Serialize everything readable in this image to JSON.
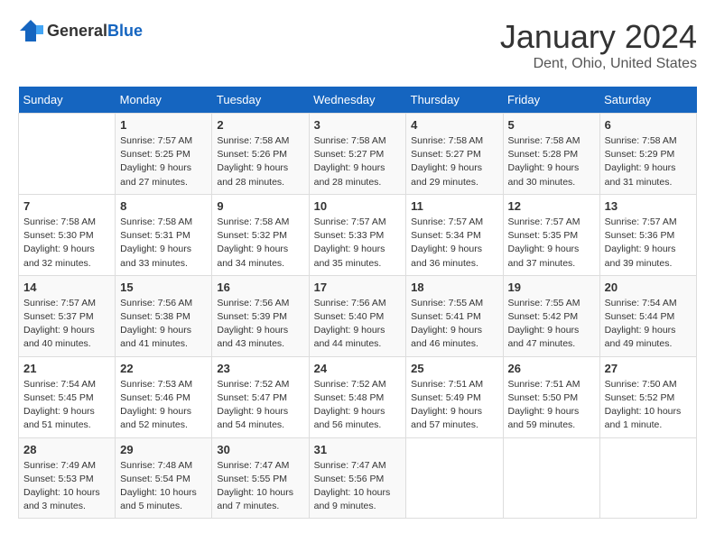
{
  "header": {
    "logo_general": "General",
    "logo_blue": "Blue",
    "title": "January 2024",
    "subtitle": "Dent, Ohio, United States"
  },
  "days_of_week": [
    "Sunday",
    "Monday",
    "Tuesday",
    "Wednesday",
    "Thursday",
    "Friday",
    "Saturday"
  ],
  "weeks": [
    [
      {
        "day": "",
        "sunrise": "",
        "sunset": "",
        "daylight": ""
      },
      {
        "day": "1",
        "sunrise": "Sunrise: 7:57 AM",
        "sunset": "Sunset: 5:25 PM",
        "daylight": "Daylight: 9 hours and 27 minutes."
      },
      {
        "day": "2",
        "sunrise": "Sunrise: 7:58 AM",
        "sunset": "Sunset: 5:26 PM",
        "daylight": "Daylight: 9 hours and 28 minutes."
      },
      {
        "day": "3",
        "sunrise": "Sunrise: 7:58 AM",
        "sunset": "Sunset: 5:27 PM",
        "daylight": "Daylight: 9 hours and 28 minutes."
      },
      {
        "day": "4",
        "sunrise": "Sunrise: 7:58 AM",
        "sunset": "Sunset: 5:27 PM",
        "daylight": "Daylight: 9 hours and 29 minutes."
      },
      {
        "day": "5",
        "sunrise": "Sunrise: 7:58 AM",
        "sunset": "Sunset: 5:28 PM",
        "daylight": "Daylight: 9 hours and 30 minutes."
      },
      {
        "day": "6",
        "sunrise": "Sunrise: 7:58 AM",
        "sunset": "Sunset: 5:29 PM",
        "daylight": "Daylight: 9 hours and 31 minutes."
      }
    ],
    [
      {
        "day": "7",
        "sunrise": "Sunrise: 7:58 AM",
        "sunset": "Sunset: 5:30 PM",
        "daylight": "Daylight: 9 hours and 32 minutes."
      },
      {
        "day": "8",
        "sunrise": "Sunrise: 7:58 AM",
        "sunset": "Sunset: 5:31 PM",
        "daylight": "Daylight: 9 hours and 33 minutes."
      },
      {
        "day": "9",
        "sunrise": "Sunrise: 7:58 AM",
        "sunset": "Sunset: 5:32 PM",
        "daylight": "Daylight: 9 hours and 34 minutes."
      },
      {
        "day": "10",
        "sunrise": "Sunrise: 7:57 AM",
        "sunset": "Sunset: 5:33 PM",
        "daylight": "Daylight: 9 hours and 35 minutes."
      },
      {
        "day": "11",
        "sunrise": "Sunrise: 7:57 AM",
        "sunset": "Sunset: 5:34 PM",
        "daylight": "Daylight: 9 hours and 36 minutes."
      },
      {
        "day": "12",
        "sunrise": "Sunrise: 7:57 AM",
        "sunset": "Sunset: 5:35 PM",
        "daylight": "Daylight: 9 hours and 37 minutes."
      },
      {
        "day": "13",
        "sunrise": "Sunrise: 7:57 AM",
        "sunset": "Sunset: 5:36 PM",
        "daylight": "Daylight: 9 hours and 39 minutes."
      }
    ],
    [
      {
        "day": "14",
        "sunrise": "Sunrise: 7:57 AM",
        "sunset": "Sunset: 5:37 PM",
        "daylight": "Daylight: 9 hours and 40 minutes."
      },
      {
        "day": "15",
        "sunrise": "Sunrise: 7:56 AM",
        "sunset": "Sunset: 5:38 PM",
        "daylight": "Daylight: 9 hours and 41 minutes."
      },
      {
        "day": "16",
        "sunrise": "Sunrise: 7:56 AM",
        "sunset": "Sunset: 5:39 PM",
        "daylight": "Daylight: 9 hours and 43 minutes."
      },
      {
        "day": "17",
        "sunrise": "Sunrise: 7:56 AM",
        "sunset": "Sunset: 5:40 PM",
        "daylight": "Daylight: 9 hours and 44 minutes."
      },
      {
        "day": "18",
        "sunrise": "Sunrise: 7:55 AM",
        "sunset": "Sunset: 5:41 PM",
        "daylight": "Daylight: 9 hours and 46 minutes."
      },
      {
        "day": "19",
        "sunrise": "Sunrise: 7:55 AM",
        "sunset": "Sunset: 5:42 PM",
        "daylight": "Daylight: 9 hours and 47 minutes."
      },
      {
        "day": "20",
        "sunrise": "Sunrise: 7:54 AM",
        "sunset": "Sunset: 5:44 PM",
        "daylight": "Daylight: 9 hours and 49 minutes."
      }
    ],
    [
      {
        "day": "21",
        "sunrise": "Sunrise: 7:54 AM",
        "sunset": "Sunset: 5:45 PM",
        "daylight": "Daylight: 9 hours and 51 minutes."
      },
      {
        "day": "22",
        "sunrise": "Sunrise: 7:53 AM",
        "sunset": "Sunset: 5:46 PM",
        "daylight": "Daylight: 9 hours and 52 minutes."
      },
      {
        "day": "23",
        "sunrise": "Sunrise: 7:52 AM",
        "sunset": "Sunset: 5:47 PM",
        "daylight": "Daylight: 9 hours and 54 minutes."
      },
      {
        "day": "24",
        "sunrise": "Sunrise: 7:52 AM",
        "sunset": "Sunset: 5:48 PM",
        "daylight": "Daylight: 9 hours and 56 minutes."
      },
      {
        "day": "25",
        "sunrise": "Sunrise: 7:51 AM",
        "sunset": "Sunset: 5:49 PM",
        "daylight": "Daylight: 9 hours and 57 minutes."
      },
      {
        "day": "26",
        "sunrise": "Sunrise: 7:51 AM",
        "sunset": "Sunset: 5:50 PM",
        "daylight": "Daylight: 9 hours and 59 minutes."
      },
      {
        "day": "27",
        "sunrise": "Sunrise: 7:50 AM",
        "sunset": "Sunset: 5:52 PM",
        "daylight": "Daylight: 10 hours and 1 minute."
      }
    ],
    [
      {
        "day": "28",
        "sunrise": "Sunrise: 7:49 AM",
        "sunset": "Sunset: 5:53 PM",
        "daylight": "Daylight: 10 hours and 3 minutes."
      },
      {
        "day": "29",
        "sunrise": "Sunrise: 7:48 AM",
        "sunset": "Sunset: 5:54 PM",
        "daylight": "Daylight: 10 hours and 5 minutes."
      },
      {
        "day": "30",
        "sunrise": "Sunrise: 7:47 AM",
        "sunset": "Sunset: 5:55 PM",
        "daylight": "Daylight: 10 hours and 7 minutes."
      },
      {
        "day": "31",
        "sunrise": "Sunrise: 7:47 AM",
        "sunset": "Sunset: 5:56 PM",
        "daylight": "Daylight: 10 hours and 9 minutes."
      },
      {
        "day": "",
        "sunrise": "",
        "sunset": "",
        "daylight": ""
      },
      {
        "day": "",
        "sunrise": "",
        "sunset": "",
        "daylight": ""
      },
      {
        "day": "",
        "sunrise": "",
        "sunset": "",
        "daylight": ""
      }
    ]
  ]
}
